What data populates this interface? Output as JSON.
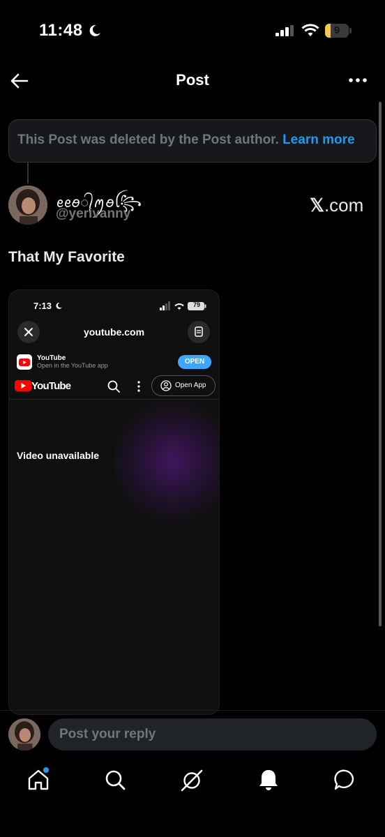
{
  "status_bar": {
    "time": "11:48",
    "battery": "9",
    "icons": [
      "moon-icon",
      "signal-icon",
      "wifi-icon",
      "battery-icon"
    ]
  },
  "header": {
    "title": "Post",
    "back_icon": "arrow-left-icon",
    "more_icon": "more-horizontal-icon"
  },
  "deleted_notice": {
    "text": "This Post was deleted by the Post author.",
    "link": "Learn more"
  },
  "post": {
    "display_name": "ꫀꫀꪮ᭄ꪑꪮꪶ꧂",
    "handle": "@yerivanny",
    "source": "X.com",
    "source_glyph": "𝕏",
    "source_rest": ".com",
    "text": "That My Favorite"
  },
  "embedded_screenshot": {
    "time": "7:13",
    "battery": "79",
    "url": "youtube.com",
    "app_banner_title": "YouTube",
    "app_banner_subtitle": "Open in the YouTube app",
    "open_button": "OPEN",
    "logo_text": "YouTube",
    "open_app_button": "Open App",
    "message": "Video unavailable"
  },
  "reply": {
    "placeholder": "Post your reply"
  },
  "tab_bar": [
    "home-icon",
    "search-icon",
    "grok-icon",
    "notifications-icon",
    "messages-icon"
  ],
  "colors": {
    "accent": "#1d9bf0",
    "muted": "#71767b",
    "background": "#000000",
    "battery": "#f2c94c"
  }
}
